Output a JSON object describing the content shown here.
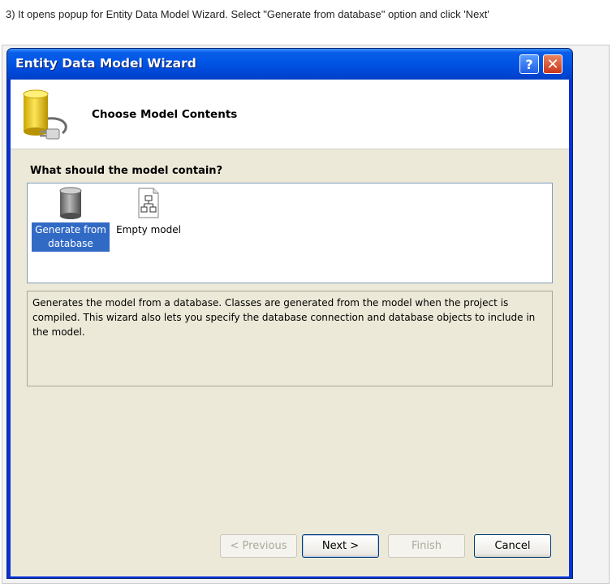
{
  "caption": "3) It opens popup for Entity Data Model Wizard. Select \"Generate from database\" option and click 'Next'",
  "window": {
    "title": "Entity Data Model Wizard",
    "help_label": "?",
    "close_label": "✕"
  },
  "header": {
    "title": "Choose Model Contents"
  },
  "section_label": "What should the model contain?",
  "model_items": [
    {
      "label": "Generate from database",
      "selected": true,
      "icon": "database-icon"
    },
    {
      "label": "Empty model",
      "selected": false,
      "icon": "diagram-icon"
    }
  ],
  "description": "Generates the model from a database. Classes are generated from the model when the project is compiled. This wizard also lets you specify the database connection and database objects to include in the model.",
  "buttons": {
    "previous": "< Previous",
    "next": "Next >",
    "finish": "Finish",
    "cancel": "Cancel"
  },
  "colors": {
    "title_bar": "#0055e5",
    "dialog_bg": "#ece9d8",
    "selection": "#316ac5",
    "close_button": "#c9361a"
  }
}
